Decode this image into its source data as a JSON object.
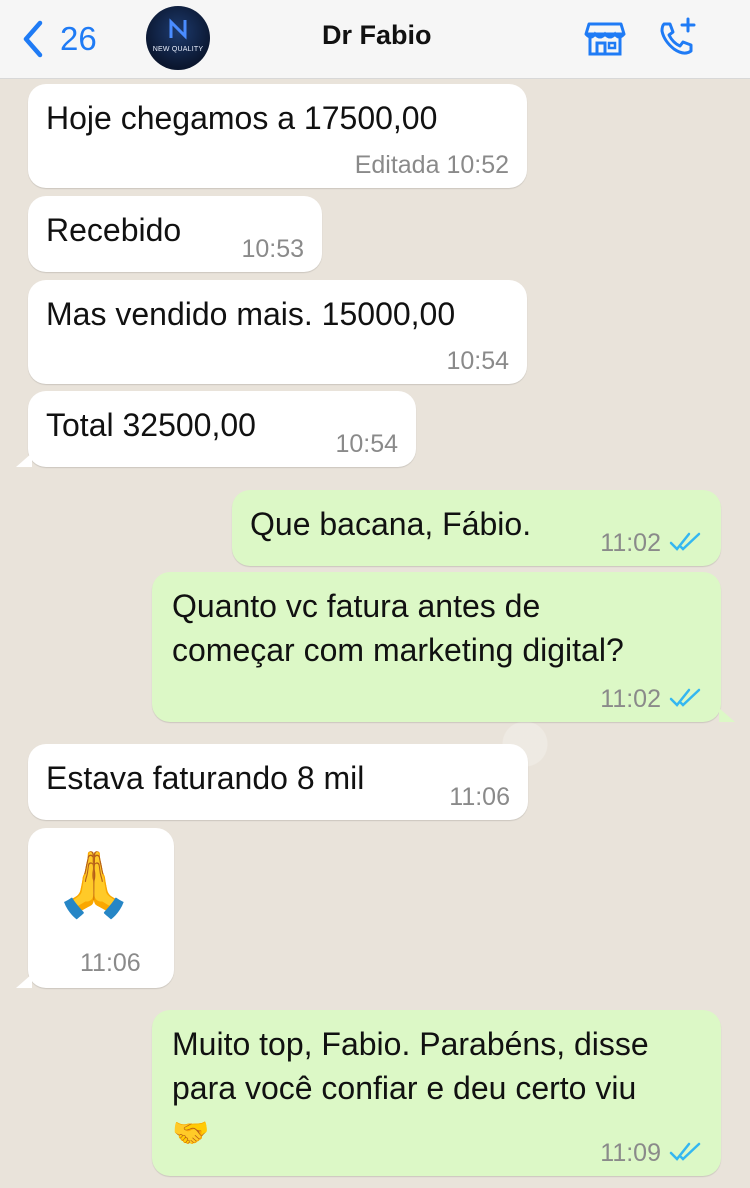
{
  "header": {
    "back_count": "26",
    "contact_name": "Dr Fabio",
    "avatar_logo_text": "NEW QUALITY",
    "icons": [
      "back-chevron-icon",
      "store-icon",
      "add-call-icon"
    ]
  },
  "messages": [
    {
      "dir": "in",
      "text": "Hoje chegamos a 17500,00",
      "time": "Editada 10:52"
    },
    {
      "dir": "in",
      "text": "Recebido",
      "time": "10:53"
    },
    {
      "dir": "in",
      "text": "Mas vendido mais. 15000,00",
      "time": "10:54"
    },
    {
      "dir": "in",
      "text": "Total 32500,00",
      "time": "10:54"
    },
    {
      "dir": "out",
      "text": "Que bacana, Fábio.",
      "time": "11:02",
      "status": "read"
    },
    {
      "dir": "out",
      "lines": [
        "Quanto vc fatura antes de",
        "começar com marketing digital?"
      ],
      "time": "11:02",
      "status": "read"
    },
    {
      "dir": "in",
      "text": "Estava faturando 8 mil",
      "time": "11:06"
    },
    {
      "dir": "in",
      "emoji": "🙏",
      "time": "11:06"
    },
    {
      "dir": "out",
      "lines": [
        "Muito top, Fabio. Parabéns, disse",
        "para você confiar e deu certo viu",
        "🤝"
      ],
      "time": "11:09",
      "status": "read"
    }
  ],
  "colors": {
    "accent": "#1f7bf5",
    "outgoing_bubble": "#dcf8c6",
    "incoming_bubble": "#ffffff",
    "read_ticks": "#34b7f1",
    "background": "#e9e3da"
  }
}
